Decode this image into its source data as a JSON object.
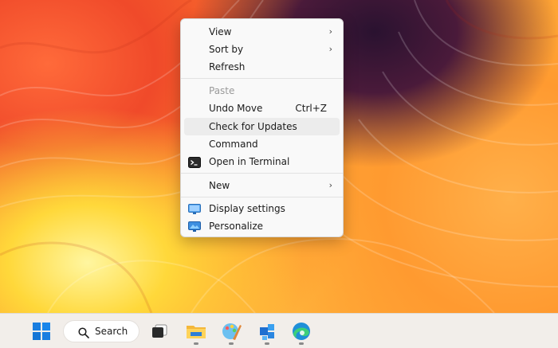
{
  "context_menu": {
    "items": [
      {
        "label": "View",
        "submenu": true
      },
      {
        "label": "Sort by",
        "submenu": true
      },
      {
        "label": "Refresh"
      },
      {
        "label": "Paste",
        "disabled": true
      },
      {
        "label": "Undo Move",
        "shortcut": "Ctrl+Z"
      },
      {
        "label": "Check for Updates",
        "highlighted": true
      },
      {
        "label": "Command"
      },
      {
        "label": "Open in Terminal",
        "icon": "terminal-icon"
      },
      {
        "label": "New",
        "submenu": true
      },
      {
        "label": "Display settings",
        "icon": "display-settings-icon"
      },
      {
        "label": "Personalize",
        "icon": "personalize-icon"
      }
    ],
    "submenu_glyph": "›"
  },
  "taskbar": {
    "search_label": "Search",
    "apps": [
      "start-icon",
      "search-icon",
      "task-view-icon",
      "file-explorer-icon",
      "paint-icon",
      "app-icon",
      "edge-icon"
    ]
  },
  "colors": {
    "menu_bg": "#f9f9f9",
    "hover_bg": "#ececec",
    "taskbar_bg": "#f2eeea",
    "windows_blue": "#0a6fd8"
  }
}
